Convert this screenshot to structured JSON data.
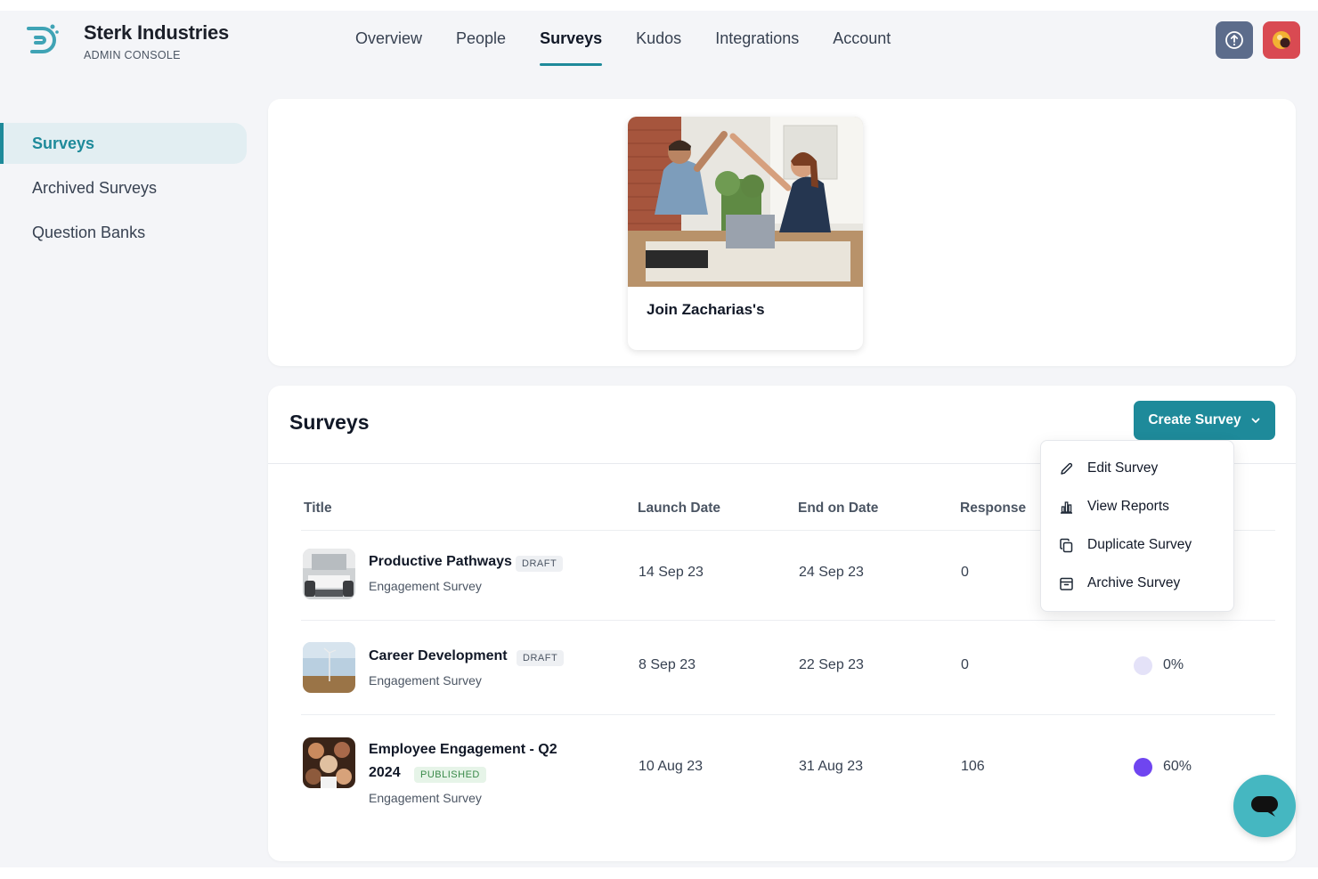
{
  "brand": {
    "name": "Sterk Industries",
    "subtitle": "ADMIN CONSOLE",
    "icon": "brand-logo-icon"
  },
  "nav": {
    "items": [
      {
        "label": "Overview",
        "active": false
      },
      {
        "label": "People",
        "active": false
      },
      {
        "label": "Surveys",
        "active": true
      },
      {
        "label": "Kudos",
        "active": false
      },
      {
        "label": "Integrations",
        "active": false
      },
      {
        "label": "Account",
        "active": false
      }
    ]
  },
  "header_actions": {
    "help_icon": "help-circle-icon",
    "avatar_icon": "user-avatar-icon"
  },
  "sidebar": {
    "items": [
      {
        "label": "Surveys",
        "active": true
      },
      {
        "label": "Archived Surveys",
        "active": false
      },
      {
        "label": "Question Banks",
        "active": false
      }
    ]
  },
  "promo": {
    "title": "Join Zacharias's"
  },
  "surveys": {
    "title": "Surveys",
    "create_label": "Create Survey",
    "columns": {
      "title": "Title",
      "launch": "Launch Date",
      "end": "End on Date",
      "response": "Response"
    },
    "rows": [
      {
        "title": "Productive Pathways",
        "status": "DRAFT",
        "type": "Engagement Survey",
        "launch": "14 Sep 23",
        "end": "24 Sep 23",
        "response": "0",
        "progress": "",
        "progress_color": ""
      },
      {
        "title": "Career Development",
        "status": "DRAFT",
        "type": "Engagement Survey",
        "launch": "8 Sep 23",
        "end": "22 Sep 23",
        "response": "0",
        "progress": "0%",
        "progress_color": "#e4e2f8"
      },
      {
        "title_line1": "Employee Engagement - Q2",
        "title_line2": "2024",
        "status": "PUBLISHED",
        "type": "Engagement Survey",
        "launch": "10 Aug 23",
        "end": "31 Aug 23",
        "response": "106",
        "progress": "60%",
        "progress_color": "#6f45f0"
      }
    ]
  },
  "dropdown": {
    "items": [
      {
        "label": "Edit Survey",
        "icon": "pencil-icon"
      },
      {
        "label": "View Reports",
        "icon": "bar-chart-icon"
      },
      {
        "label": "Duplicate Survey",
        "icon": "copy-icon"
      },
      {
        "label": "Archive Survey",
        "icon": "archive-icon"
      }
    ]
  },
  "chat": {
    "icon": "chat-bubble-icon"
  },
  "colors": {
    "accent": "#1e8a9a",
    "background": "#f4f5f8",
    "help_button": "#5c6c8b",
    "avatar_button": "#d94a52",
    "chat": "#45b7c1"
  }
}
